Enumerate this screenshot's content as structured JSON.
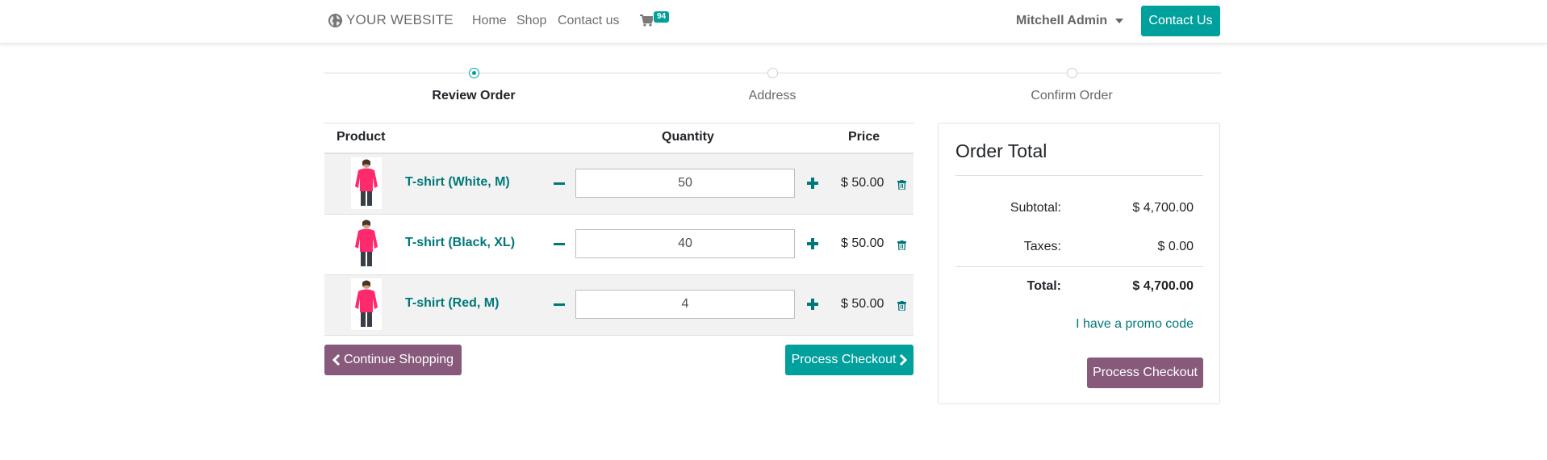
{
  "navbar": {
    "brand": "YOUR WEBSITE",
    "links": [
      "Home",
      "Shop",
      "Contact us"
    ],
    "cart_count": "94",
    "user": "Mitchell Admin",
    "contact_button": "Contact Us",
    "accent_color": "#00a09d"
  },
  "wizard": {
    "steps": [
      "Review Order",
      "Address",
      "Confirm Order"
    ],
    "active_step": "Review Order"
  },
  "cart": {
    "headers": {
      "product": "Product",
      "quantity": "Quantity",
      "price": "Price"
    },
    "items": [
      {
        "name": "T-shirt (White, M)",
        "quantity": "50",
        "price": "$ 50.00"
      },
      {
        "name": "T-shirt (Black, XL)",
        "quantity": "40",
        "price": "$ 50.00"
      },
      {
        "name": "T-shirt (Red, M)",
        "quantity": "4",
        "price": "$ 50.00"
      }
    ],
    "continue_label": "Continue Shopping",
    "checkout_label": "Process Checkout"
  },
  "summary": {
    "title": "Order Total",
    "subtotal_label": "Subtotal:",
    "subtotal_value": "$ 4,700.00",
    "taxes_label": "Taxes:",
    "taxes_value": "$ 0.00",
    "total_label": "Total:",
    "total_value": "$ 4,700.00",
    "promo_label": "I have a promo code",
    "checkout_label": "Process Checkout",
    "secondary_color": "#875a7b"
  }
}
